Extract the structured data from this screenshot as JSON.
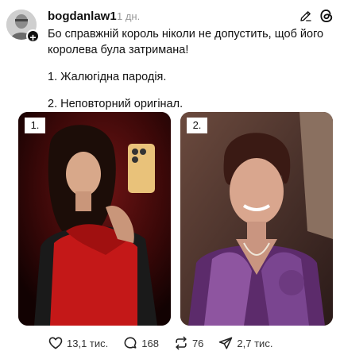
{
  "post": {
    "username": "bogdanlaw1",
    "timestamp": "1 дн.",
    "paragraph1": "Бо справжній король ніколи не допустить, щоб його королева була затримана!",
    "paragraph2": "1. Жалюгідна пародія.",
    "paragraph3": "2. Неповторний оригінал."
  },
  "media": [
    {
      "label": "1."
    },
    {
      "label": "2."
    }
  ],
  "actions": {
    "likes": "13,1 тис.",
    "comments": "168",
    "reposts": "76",
    "shares": "2,7 тис."
  },
  "icons": {
    "avatar_badge": "plus-icon",
    "edit": "pencil-icon",
    "brand": "threads-logo-icon",
    "like": "heart-icon",
    "comment": "comment-bubble-icon",
    "repost": "repost-icon",
    "share": "send-icon"
  }
}
